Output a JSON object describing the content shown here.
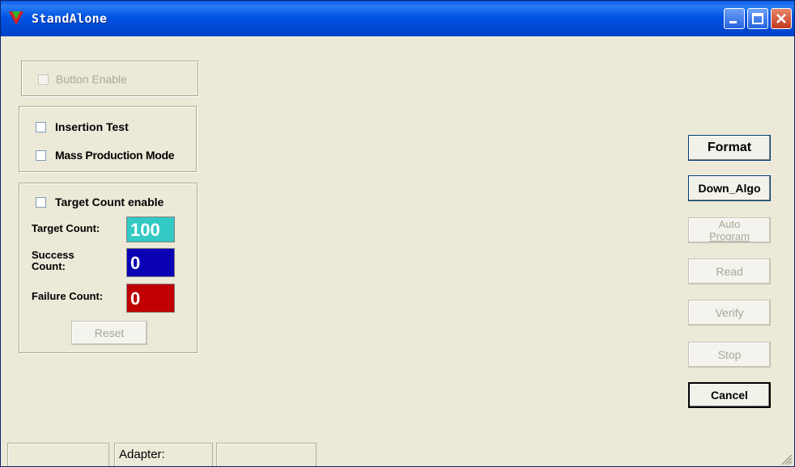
{
  "window": {
    "title": "StandAlone"
  },
  "top_group": {
    "button_enable_label": "Button Enable"
  },
  "mode_group": {
    "insertion_test_label": "Insertion Test",
    "mass_production_label": "Mass Production Mode"
  },
  "target_group": {
    "target_count_enable_label": "Target Count enable",
    "target_count_label": "Target Count:",
    "target_count_value": "100",
    "success_count_label_line1": "Success",
    "success_count_label_line2": "Count:",
    "success_count_value": "0",
    "failure_count_label": "Failure Count:",
    "failure_count_value": "0",
    "reset_label": "Reset"
  },
  "actions": {
    "format_label": "Format",
    "down_algo_label": "Down_Algo",
    "auto_program_line1": "Auto",
    "auto_program_line2": "Program",
    "read_label": "Read",
    "verify_label": "Verify",
    "stop_label": "Stop",
    "cancel_label": "Cancel"
  },
  "statusbar": {
    "pane2": "Adapter:"
  },
  "colors": {
    "target_count_bg": "#33c9c4",
    "success_count_bg": "#0a00b4",
    "failure_count_bg": "#c00000",
    "titlebar": "#0054e3"
  }
}
